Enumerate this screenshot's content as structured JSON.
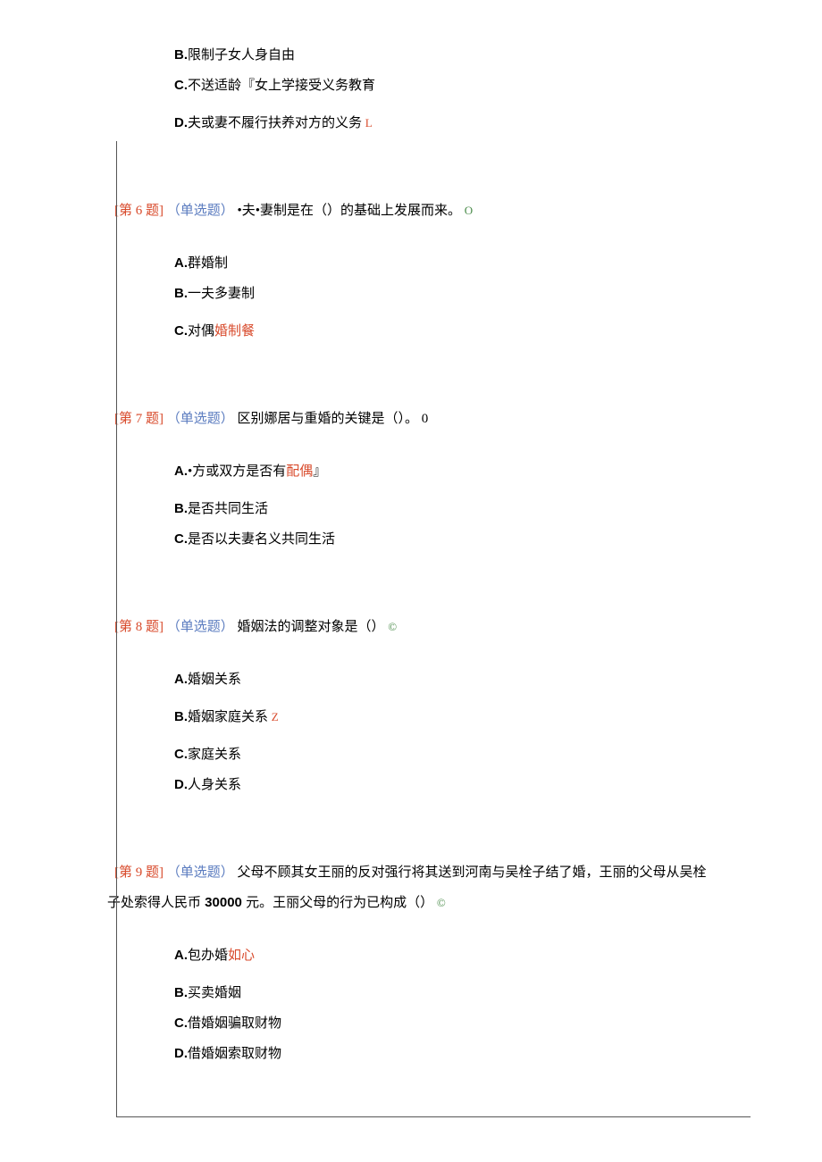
{
  "q5_opts": {
    "B": {
      "letter": "B.",
      "text": "限制子女人身自由"
    },
    "C": {
      "letter": "C.",
      "text": "不送适龄『女上学接受义务教育"
    },
    "D": {
      "letter": "D.",
      "text": "夫或妻不履行扶养对方的义务",
      "mark": "L"
    }
  },
  "q6": {
    "num": "[第 6 题]",
    "type": "（单选题）",
    "stem": "•夫•妻制是在（）的基础上发展而来。",
    "mark": "O",
    "opts": {
      "A": {
        "letter": "A.",
        "text": "群婚制"
      },
      "B": {
        "letter": "B.",
        "text": "一夫多妻制"
      },
      "C": {
        "letter": "C.",
        "pre": "对偶",
        "red": "婚制餐"
      }
    }
  },
  "q7": {
    "num": "[第 7 题]",
    "type": "（单选题）",
    "stem": "区别娜居与重婚的关键是（）。",
    "mark": "0",
    "opts": {
      "A": {
        "letter": "A.",
        "pre": "•方或双方是否有",
        "red": "配偶",
        "post": "』"
      },
      "B": {
        "letter": "B.",
        "text": "是否共同生活"
      },
      "C": {
        "letter": "C.",
        "text": "是否以夫妻名义共同生活"
      }
    }
  },
  "q8": {
    "num": "[第 8 题]",
    "type": "（单选题）",
    "stem": "婚姻法的调整对象是（）",
    "mark": "©",
    "opts": {
      "A": {
        "letter": "A.",
        "text": "婚姻关系"
      },
      "B": {
        "letter": "B.",
        "text": "婚姻家庭关系",
        "mark": "Z"
      },
      "C": {
        "letter": "C.",
        "text": "家庭关系"
      },
      "D": {
        "letter": "D.",
        "text": "人身关系"
      }
    }
  },
  "q9": {
    "num": "[第 9 题]",
    "type": "（单选题）",
    "stem_a": "父母不顾其女王丽的反对强行将其送到河南与吴栓子结了婚，王丽的父母从吴栓",
    "stem_b1": "子处索得人民币",
    "stem_b_bold": " 30000 ",
    "stem_b2": "元。王丽父母的行为已构成（）",
    "mark": "©",
    "opts": {
      "A": {
        "letter": "A.",
        "pre": "包办婚",
        "red": "如心"
      },
      "B": {
        "letter": "B.",
        "text": "买卖婚姻"
      },
      "C": {
        "letter": "C.",
        "text": "借婚姻骗取财物"
      },
      "D": {
        "letter": "D.",
        "text": "借婚姻索取财物"
      }
    }
  }
}
